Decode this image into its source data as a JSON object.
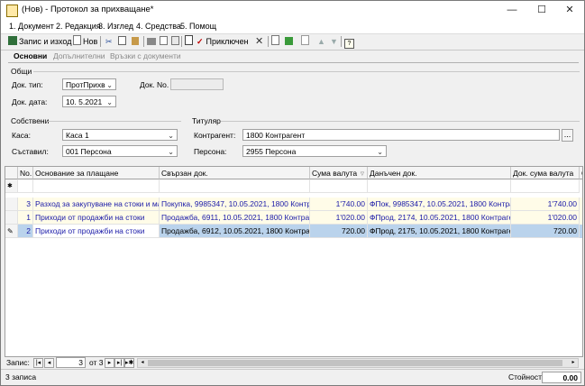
{
  "window": {
    "title": "(Нов) - Протокол за прихващане*",
    "minimize": "—",
    "maximize": "☐",
    "close": "✕"
  },
  "menu": [
    "1. Документ",
    "2. Редакция",
    "3. Изглед",
    "4. Средства",
    "5. Помощ"
  ],
  "toolbar": {
    "save_exit": "Запис и изход",
    "new": "Нов",
    "finish": "Приключен"
  },
  "tabs": [
    "Основни",
    "Допълнителни",
    "Връзки с документи"
  ],
  "general": {
    "group_label": "Общи",
    "doc_type_label": "Док. тип:",
    "doc_type_value": "ПротПрихв",
    "doc_no_label": "Док. No.",
    "doc_no_value": "",
    "doc_date_label": "Док. дата:",
    "doc_date_value": "10. 5.2021"
  },
  "own": {
    "group_label": "Собствени",
    "cash_label": "Каса:",
    "cash_value": "Каса 1",
    "author_label": "Съставил:",
    "author_value": "001 Персона"
  },
  "holder": {
    "group_label": "Титуляр",
    "contractor_label": "Контрагент:",
    "contractor_value": "1800 Контрагент",
    "person_label": "Персона:",
    "person_value": "2955 Персона",
    "ellipsis": "..."
  },
  "grid": {
    "columns": [
      "No.",
      "Основание за плащане",
      "Свързан док.",
      "Сума валута",
      "Данъчен док.",
      "Док. сума валута",
      "С"
    ],
    "new_row_marker": "✱",
    "edit_marker": "✎",
    "rows": [
      {
        "no": "3",
        "basis": "Разход за закупуване на стоки и ма...",
        "linked": "Покупка, 9985347, 10.05.2021, 1800 Контраг...",
        "amount": "1'740.00",
        "tax": "ФПок, 9985347, 10.05.2021, 1800 Контраге...",
        "doc_amount": "1'740.00"
      },
      {
        "no": "1",
        "basis": "Приходи от продажби на стоки",
        "linked": "Продажба, 6911, 10.05.2021, 1800 Контрагент",
        "amount": "1'020.00",
        "tax": "ФПрод, 2174, 10.05.2021, 1800 Контрагент",
        "doc_amount": "1'020.00"
      },
      {
        "no": "2",
        "basis": "Приходи от продажби на стоки",
        "linked": "Продажба, 6912, 10.05.2021, 1800 Контрагент",
        "amount": "720.00",
        "tax": "ФПрод, 2175, 10.05.2021, 1800 Контрагент",
        "doc_amount": "720.00"
      }
    ]
  },
  "nav": {
    "label": "Запис:",
    "current": "3",
    "of_total": "от 3"
  },
  "status": {
    "count": "3 записа",
    "value_label": "Стойност:",
    "value": "0.00"
  },
  "colors": {
    "selected_row": "#bad3ec",
    "link_text": "#1a1aa8",
    "yellow_row": "#fffce8"
  }
}
